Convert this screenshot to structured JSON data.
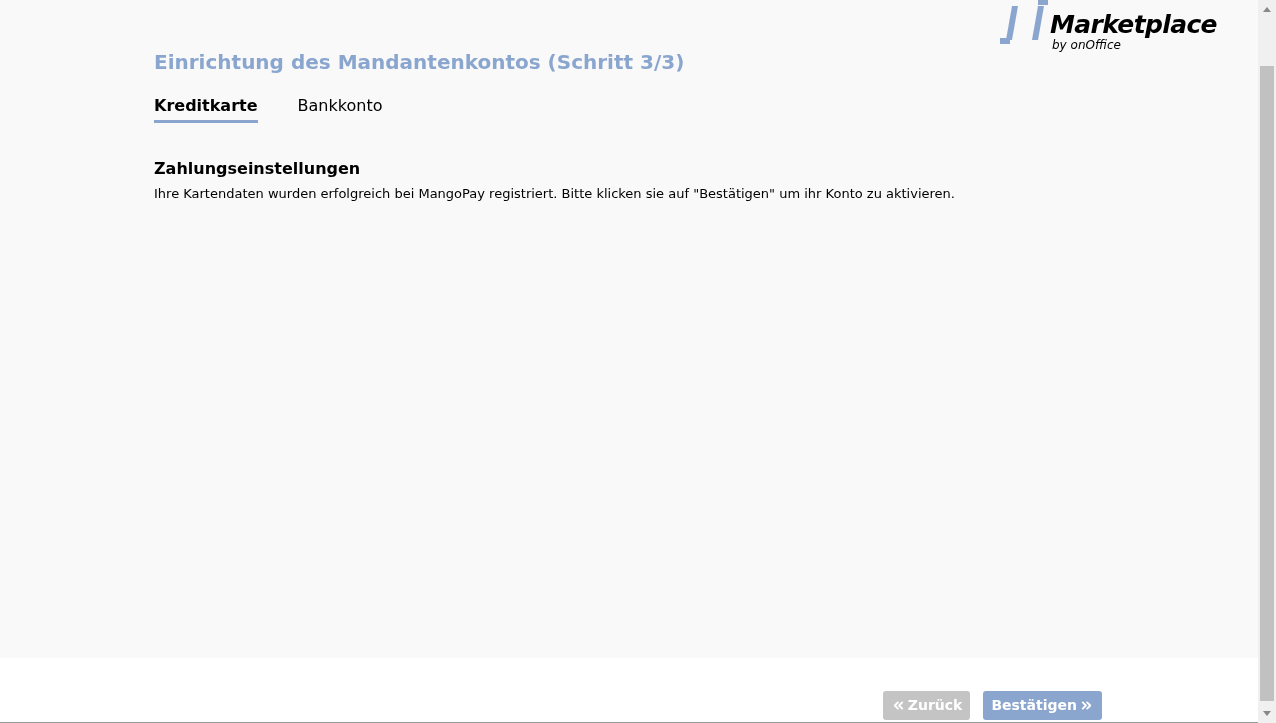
{
  "logo": {
    "name": "Marketplace",
    "subtitle": "by onOffice"
  },
  "title": "Einrichtung des Mandantenkontos (Schritt 3/3)",
  "tabs": [
    {
      "label": "Kreditkarte",
      "selected": true
    },
    {
      "label": "Bankkonto",
      "selected": false
    }
  ],
  "section": {
    "heading": "Zahlungseinstellungen",
    "text": "Ihre Kartendaten wurden erfolgreich bei MangoPay registriert. Bitte klicken sie auf \"Bestätigen\" um ihr Konto zu aktivieren."
  },
  "buttons": [
    {
      "kind": "back",
      "label": "Zurück",
      "disabled": true
    },
    {
      "kind": "next",
      "label": "Bestätigen",
      "disabled": false
    }
  ]
}
